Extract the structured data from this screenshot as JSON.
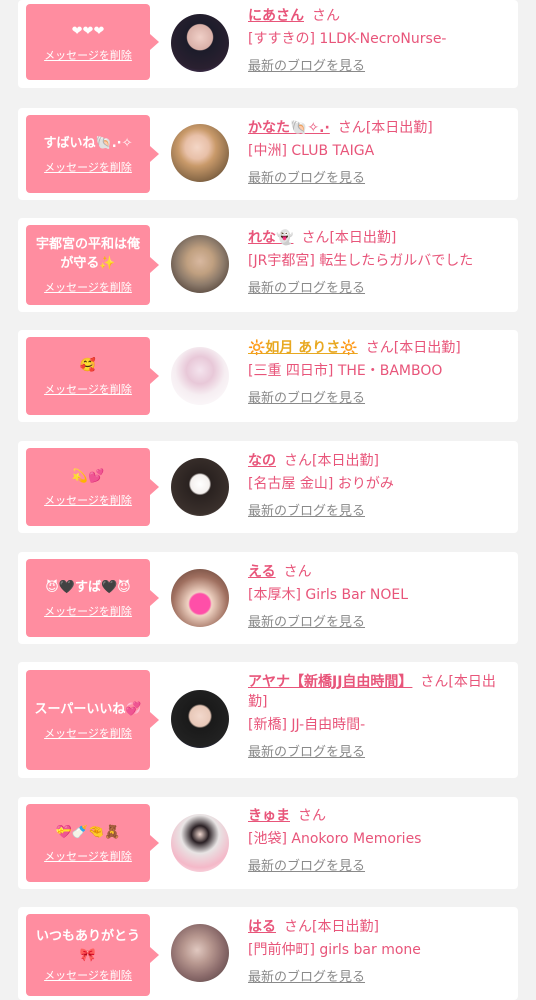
{
  "common": {
    "delete_label": "メッセージを削除",
    "blog_label": "最新のブログを見る",
    "san": "さん"
  },
  "cards": [
    {
      "message": "❤❤❤",
      "name": "にあさん",
      "status": "",
      "shop": "[すすきの] 1LDK-NecroNurse-"
    },
    {
      "message": "すばいね🐚.·✧",
      "name": "かなた🐚✧.·",
      "status": "[本日出勤]",
      "shop": "[中洲] CLUB TAIGA"
    },
    {
      "message": "宇都宮の平和は俺が守る✨",
      "name": "れな👻",
      "status": "[本日出勤]",
      "shop": "[JR宇都宮] 転生したらガルバでした"
    },
    {
      "message": "🥰",
      "name": "🔆如月 ありさ🔆",
      "status": "[本日出勤]",
      "shop": "[三重 四日市] THE・BAMBOO"
    },
    {
      "message": "💫💕",
      "name": "なの",
      "status": "[本日出勤]",
      "shop": "[名古屋 金山] おりがみ"
    },
    {
      "message": "😈🖤すば🖤😈",
      "name": "える",
      "status": "",
      "shop": "[本厚木] Girls Bar NOEL"
    },
    {
      "message": "スーパーいいね💞",
      "name": "アヤナ【新橋JJ自由時間】",
      "status": "[本日出勤]",
      "shop": "[新橋] JJ-自由時間-"
    },
    {
      "message": "💝🍼🤏🧸",
      "name": "きゅま",
      "status": "",
      "shop": "[池袋] Anokoro Memories"
    },
    {
      "message": "いつもありがとう🎀",
      "name": "はる",
      "status": "[本日出勤]",
      "shop": "[門前仲町] girls bar mone"
    }
  ]
}
